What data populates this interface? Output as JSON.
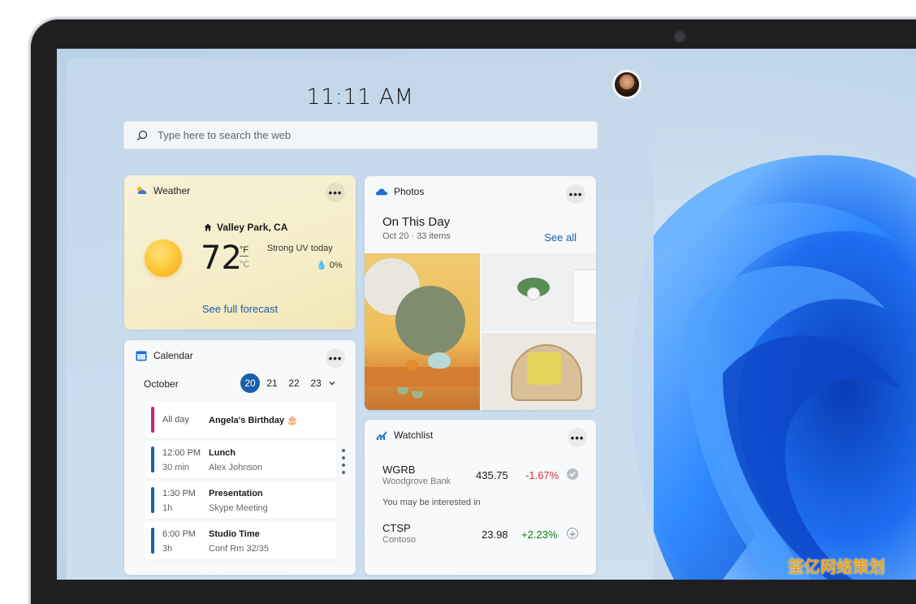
{
  "clock": "11:11 AM",
  "search": {
    "placeholder": "Type here to search the web"
  },
  "weather": {
    "title": "Weather",
    "location": "Valley Park, CA",
    "temperature": "72",
    "unit_f": "°F",
    "unit_c": "°C",
    "uv": "Strong UV today",
    "precip": "0%",
    "forecast_link": "See full forecast",
    "more": "•••"
  },
  "photos": {
    "title": "Photos",
    "heading": "On This Day",
    "subtitle": "Oct 20 · 33 items",
    "see_all": "See all",
    "more": "•••"
  },
  "calendar": {
    "title": "Calendar",
    "month": "October",
    "days": [
      "20",
      "21",
      "22",
      "23"
    ],
    "selected_day": "20",
    "more": "•••",
    "events": [
      {
        "time": "All day",
        "duration": "",
        "name": "Angela's Birthday",
        "detail": "",
        "color": "#c5257d"
      },
      {
        "time": "12:00 PM",
        "duration": "30 min",
        "name": "Lunch",
        "detail": "Alex Johnson",
        "color": "#1b5eab"
      },
      {
        "time": "1:30 PM",
        "duration": "1h",
        "name": "Presentation",
        "detail": "Skype Meeting",
        "color": "#1b5eab"
      },
      {
        "time": "6:00 PM",
        "duration": "3h",
        "name": "Studio Time",
        "detail": "Conf Rm 32/35",
        "color": "#1b5eab"
      }
    ]
  },
  "watchlist": {
    "title": "Watchlist",
    "more": "•••",
    "interest_label": "You may be interested in",
    "stocks": [
      {
        "symbol": "WGRB",
        "name": "Woodgrove Bank",
        "price": "435.75",
        "change": "-1.67%",
        "change_color": "#d13438"
      },
      {
        "symbol": "CTSP",
        "name": "Contoso",
        "price": "23.98",
        "change": "+2.23%",
        "change_color": "#107c10"
      }
    ]
  },
  "watermark": "筌亿网络策划"
}
